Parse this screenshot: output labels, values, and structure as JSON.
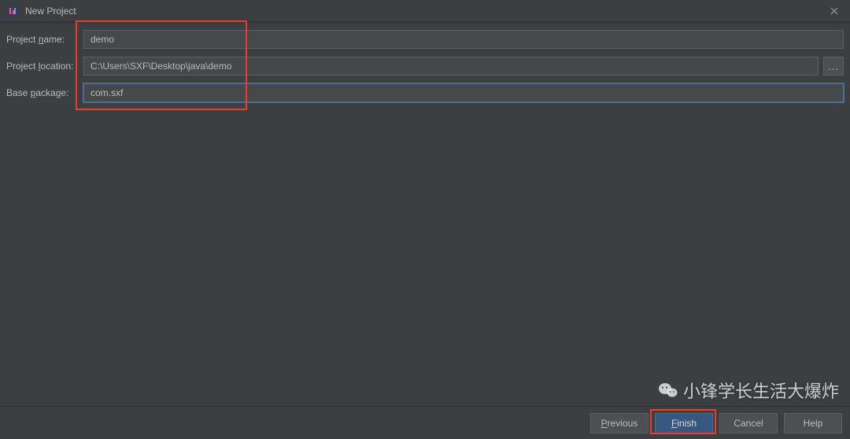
{
  "window": {
    "title": "New Project"
  },
  "form": {
    "project_name": {
      "label": "Project name:",
      "label_mn_index": 8,
      "value": "demo"
    },
    "project_location": {
      "label": "Project location:",
      "label_mn_index": 8,
      "value": "C:\\Users\\SXF\\Desktop\\java\\demo"
    },
    "base_package": {
      "label": "Base package:",
      "label_mn_index": 5,
      "value": "com.sxf"
    },
    "browse_label": "..."
  },
  "buttons": {
    "previous": "Previous",
    "finish": "Finish",
    "cancel": "Cancel",
    "help": "Help"
  },
  "watermark": {
    "text": "小锋学长生活大爆炸"
  }
}
